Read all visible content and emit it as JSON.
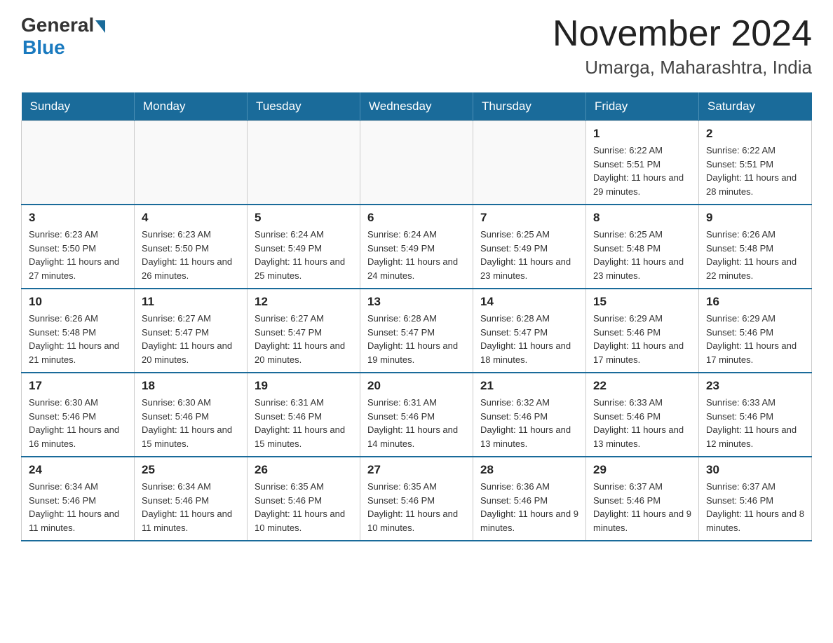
{
  "header": {
    "logo_general": "General",
    "logo_blue": "Blue",
    "title": "November 2024",
    "subtitle": "Umarga, Maharashtra, India"
  },
  "weekdays": [
    "Sunday",
    "Monday",
    "Tuesday",
    "Wednesday",
    "Thursday",
    "Friday",
    "Saturday"
  ],
  "weeks": [
    [
      {
        "day": "",
        "info": ""
      },
      {
        "day": "",
        "info": ""
      },
      {
        "day": "",
        "info": ""
      },
      {
        "day": "",
        "info": ""
      },
      {
        "day": "",
        "info": ""
      },
      {
        "day": "1",
        "info": "Sunrise: 6:22 AM\nSunset: 5:51 PM\nDaylight: 11 hours and 29 minutes."
      },
      {
        "day": "2",
        "info": "Sunrise: 6:22 AM\nSunset: 5:51 PM\nDaylight: 11 hours and 28 minutes."
      }
    ],
    [
      {
        "day": "3",
        "info": "Sunrise: 6:23 AM\nSunset: 5:50 PM\nDaylight: 11 hours and 27 minutes."
      },
      {
        "day": "4",
        "info": "Sunrise: 6:23 AM\nSunset: 5:50 PM\nDaylight: 11 hours and 26 minutes."
      },
      {
        "day": "5",
        "info": "Sunrise: 6:24 AM\nSunset: 5:49 PM\nDaylight: 11 hours and 25 minutes."
      },
      {
        "day": "6",
        "info": "Sunrise: 6:24 AM\nSunset: 5:49 PM\nDaylight: 11 hours and 24 minutes."
      },
      {
        "day": "7",
        "info": "Sunrise: 6:25 AM\nSunset: 5:49 PM\nDaylight: 11 hours and 23 minutes."
      },
      {
        "day": "8",
        "info": "Sunrise: 6:25 AM\nSunset: 5:48 PM\nDaylight: 11 hours and 23 minutes."
      },
      {
        "day": "9",
        "info": "Sunrise: 6:26 AM\nSunset: 5:48 PM\nDaylight: 11 hours and 22 minutes."
      }
    ],
    [
      {
        "day": "10",
        "info": "Sunrise: 6:26 AM\nSunset: 5:48 PM\nDaylight: 11 hours and 21 minutes."
      },
      {
        "day": "11",
        "info": "Sunrise: 6:27 AM\nSunset: 5:47 PM\nDaylight: 11 hours and 20 minutes."
      },
      {
        "day": "12",
        "info": "Sunrise: 6:27 AM\nSunset: 5:47 PM\nDaylight: 11 hours and 20 minutes."
      },
      {
        "day": "13",
        "info": "Sunrise: 6:28 AM\nSunset: 5:47 PM\nDaylight: 11 hours and 19 minutes."
      },
      {
        "day": "14",
        "info": "Sunrise: 6:28 AM\nSunset: 5:47 PM\nDaylight: 11 hours and 18 minutes."
      },
      {
        "day": "15",
        "info": "Sunrise: 6:29 AM\nSunset: 5:46 PM\nDaylight: 11 hours and 17 minutes."
      },
      {
        "day": "16",
        "info": "Sunrise: 6:29 AM\nSunset: 5:46 PM\nDaylight: 11 hours and 17 minutes."
      }
    ],
    [
      {
        "day": "17",
        "info": "Sunrise: 6:30 AM\nSunset: 5:46 PM\nDaylight: 11 hours and 16 minutes."
      },
      {
        "day": "18",
        "info": "Sunrise: 6:30 AM\nSunset: 5:46 PM\nDaylight: 11 hours and 15 minutes."
      },
      {
        "day": "19",
        "info": "Sunrise: 6:31 AM\nSunset: 5:46 PM\nDaylight: 11 hours and 15 minutes."
      },
      {
        "day": "20",
        "info": "Sunrise: 6:31 AM\nSunset: 5:46 PM\nDaylight: 11 hours and 14 minutes."
      },
      {
        "day": "21",
        "info": "Sunrise: 6:32 AM\nSunset: 5:46 PM\nDaylight: 11 hours and 13 minutes."
      },
      {
        "day": "22",
        "info": "Sunrise: 6:33 AM\nSunset: 5:46 PM\nDaylight: 11 hours and 13 minutes."
      },
      {
        "day": "23",
        "info": "Sunrise: 6:33 AM\nSunset: 5:46 PM\nDaylight: 11 hours and 12 minutes."
      }
    ],
    [
      {
        "day": "24",
        "info": "Sunrise: 6:34 AM\nSunset: 5:46 PM\nDaylight: 11 hours and 11 minutes."
      },
      {
        "day": "25",
        "info": "Sunrise: 6:34 AM\nSunset: 5:46 PM\nDaylight: 11 hours and 11 minutes."
      },
      {
        "day": "26",
        "info": "Sunrise: 6:35 AM\nSunset: 5:46 PM\nDaylight: 11 hours and 10 minutes."
      },
      {
        "day": "27",
        "info": "Sunrise: 6:35 AM\nSunset: 5:46 PM\nDaylight: 11 hours and 10 minutes."
      },
      {
        "day": "28",
        "info": "Sunrise: 6:36 AM\nSunset: 5:46 PM\nDaylight: 11 hours and 9 minutes."
      },
      {
        "day": "29",
        "info": "Sunrise: 6:37 AM\nSunset: 5:46 PM\nDaylight: 11 hours and 9 minutes."
      },
      {
        "day": "30",
        "info": "Sunrise: 6:37 AM\nSunset: 5:46 PM\nDaylight: 11 hours and 8 minutes."
      }
    ]
  ]
}
